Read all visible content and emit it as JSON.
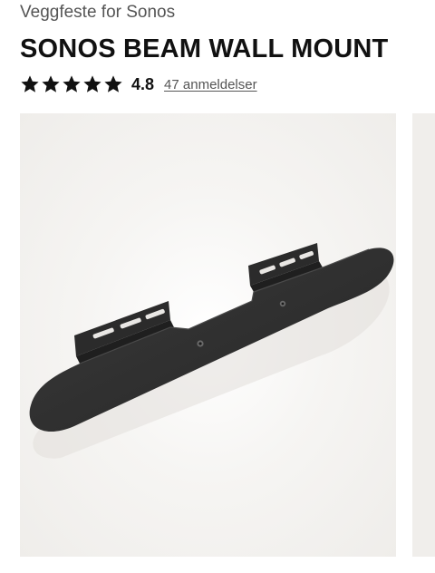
{
  "product": {
    "category": "Veggfeste for Sonos",
    "title": "SONOS BEAM WALL MOUNT"
  },
  "rating": {
    "value": "4.8",
    "stars": 5,
    "reviews_label": "47 anmeldelser"
  },
  "gallery": {
    "visible_slides": 2
  },
  "colors": {
    "text": "#111111",
    "muted": "#555555",
    "image_bg": "#f0eeeb",
    "mount": "#2f2f2f"
  }
}
